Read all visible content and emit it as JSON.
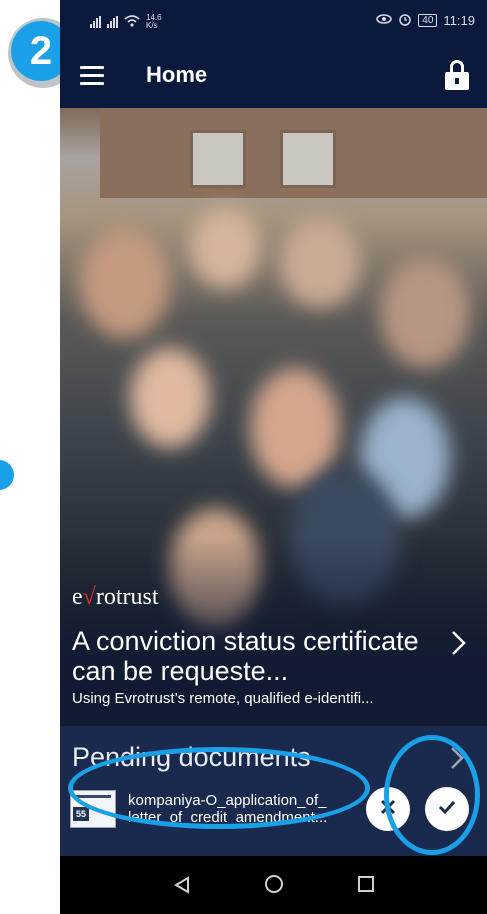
{
  "step": {
    "number": "2"
  },
  "status_bar": {
    "speed_value": "14.6",
    "speed_unit": "K/s",
    "battery": "40",
    "time": "11:19"
  },
  "app_bar": {
    "title": "Home"
  },
  "hero": {
    "brand": "evrotrust",
    "headline": "A conviction status certificate can be requeste...",
    "subtitle": "Using Evrotrust’s remote, qualified e-identifi..."
  },
  "pending": {
    "title": "Pending documents",
    "document": {
      "name_line1": "kompaniya-O_application_of_",
      "name_line2": "letter_of_credit_amendment..."
    }
  },
  "colors": {
    "accent": "#1aa0e6",
    "header": "#0b1a3c",
    "panel": "#1a2a4e",
    "brand_v": "#e0302a"
  },
  "icons": [
    "menu-icon",
    "lock-icon",
    "chevron-right-icon",
    "reject-x-icon",
    "approve-check-icon",
    "nav-back-icon",
    "nav-home-icon",
    "nav-recents-icon"
  ]
}
